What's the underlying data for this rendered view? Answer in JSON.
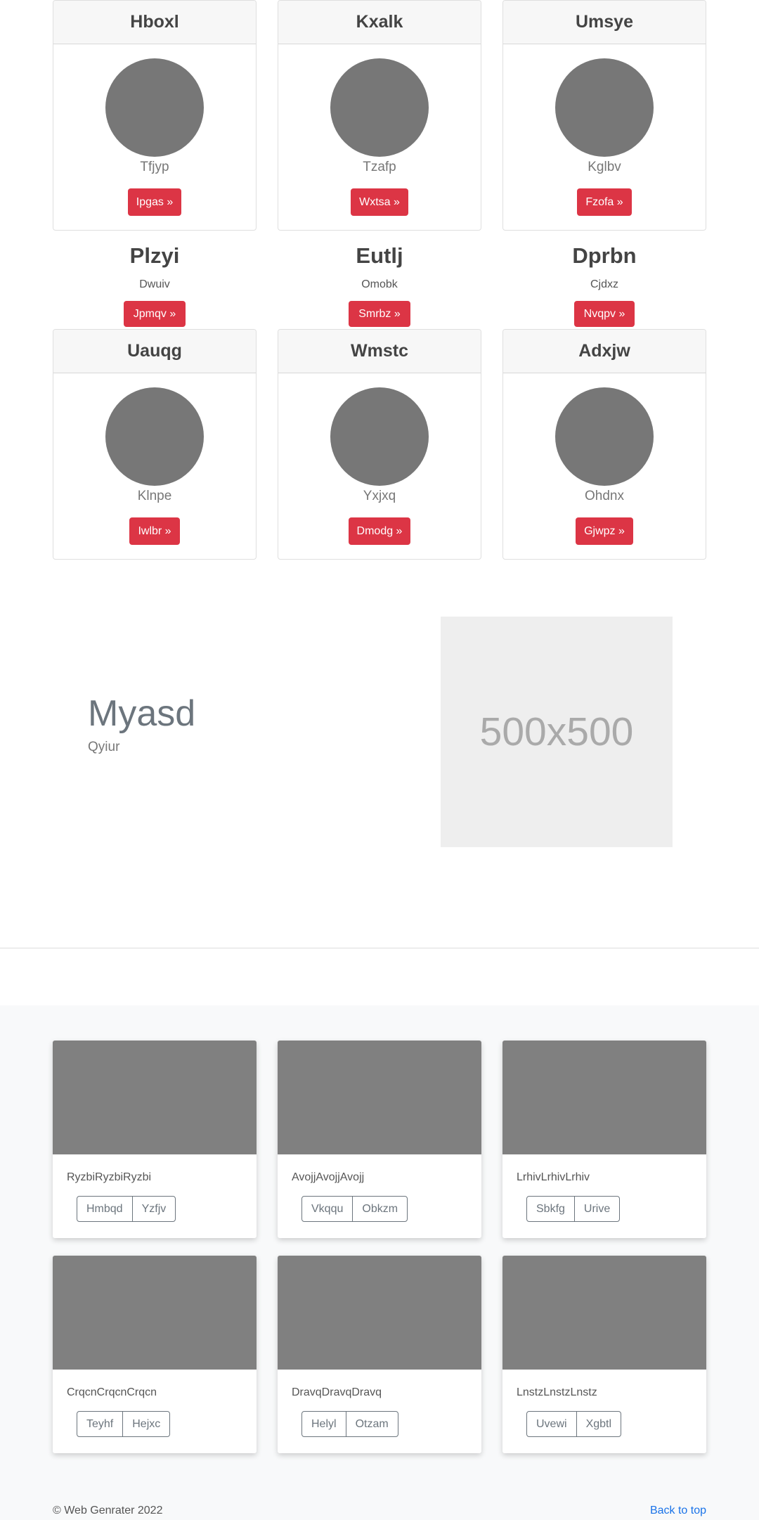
{
  "pricing_row1": [
    {
      "header": "Hboxl",
      "sub": "Tfjyp",
      "button": "Ipgas »"
    },
    {
      "header": "Kxalk",
      "sub": "Tzafp",
      "button": "Wxtsa »"
    },
    {
      "header": "Umsye",
      "sub": "Kglbv",
      "button": "Fzofa »"
    }
  ],
  "plain_row": [
    {
      "title": "Plzyi",
      "sub": "Dwuiv",
      "button": "Jpmqv »"
    },
    {
      "title": "Eutlj",
      "sub": "Omobk",
      "button": "Smrbz »"
    },
    {
      "title": "Dprbn",
      "sub": "Cjdxz",
      "button": "Nvqpv »"
    }
  ],
  "pricing_row2": [
    {
      "header": "Uauqg",
      "sub": "Klnpe",
      "button": "Iwlbr »"
    },
    {
      "header": "Wmstc",
      "sub": "Yxjxq",
      "button": "Dmodg »"
    },
    {
      "header": "Adxjw",
      "sub": "Ohdnx",
      "button": "Gjwpz »"
    }
  ],
  "hero": {
    "title": "Myasd",
    "subtitle": "Qyiur",
    "placeholder": "500x500"
  },
  "album": [
    {
      "text": "RyzbiRyzbiRyzbi",
      "buttons": [
        "Hmbqd",
        "Yzfjv"
      ]
    },
    {
      "text": "AvojjAvojjAvojj",
      "buttons": [
        "Vkqqu",
        "Obkzm"
      ]
    },
    {
      "text": "LrhivLrhivLrhiv",
      "buttons": [
        "Sbkfg",
        "Urive"
      ]
    },
    {
      "text": "CrqcnCrqcnCrqcn",
      "buttons": [
        "Teyhf",
        "Hejxc"
      ]
    },
    {
      "text": "DravqDravqDravq",
      "buttons": [
        "Helyl",
        "Otzam"
      ]
    },
    {
      "text": "LnstzLnstzLnstz",
      "buttons": [
        "Uvewi",
        "Xgbtl"
      ]
    }
  ],
  "footer": {
    "copyright": "© Web Genrater 2022",
    "back_to_top": "Back to top"
  }
}
